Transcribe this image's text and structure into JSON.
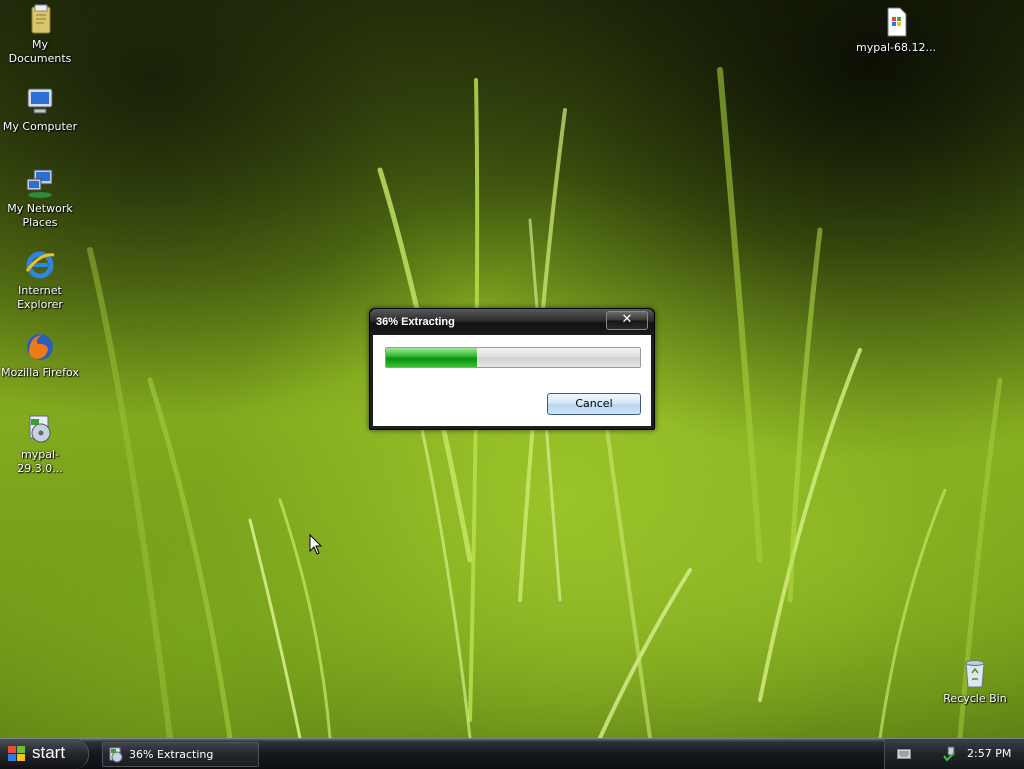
{
  "desktop": {
    "icons": [
      {
        "name": "My Documents",
        "icon": "folder-documents-icon"
      },
      {
        "name": "My Computer",
        "icon": "computer-icon"
      },
      {
        "name_line1": "My Network",
        "name_line2": "Places",
        "icon": "network-icon"
      },
      {
        "name_line1": "Internet",
        "name_line2": "Explorer",
        "icon": "internet-explorer-icon"
      },
      {
        "name": "Mozilla Firefox",
        "icon": "firefox-icon"
      },
      {
        "name": "mypal-29.3.0...",
        "icon": "installer-icon"
      },
      {
        "name": "mypal-68.12...",
        "icon": "file-icon"
      },
      {
        "name": "Recycle Bin",
        "icon": "recycle-bin-icon"
      }
    ]
  },
  "dialog": {
    "title": "36% Extracting",
    "close_label": "✕",
    "progress_percent": 36,
    "progress_visual_fraction": 0.36,
    "cancel_label": "Cancel"
  },
  "taskbar": {
    "start_label": "start",
    "task_label": "36% Extracting",
    "clock": "2:57 PM"
  },
  "colors": {
    "progress_green": "#1aa81a",
    "button_blue": "#c9e0f6",
    "taskbar": "#15181c"
  }
}
